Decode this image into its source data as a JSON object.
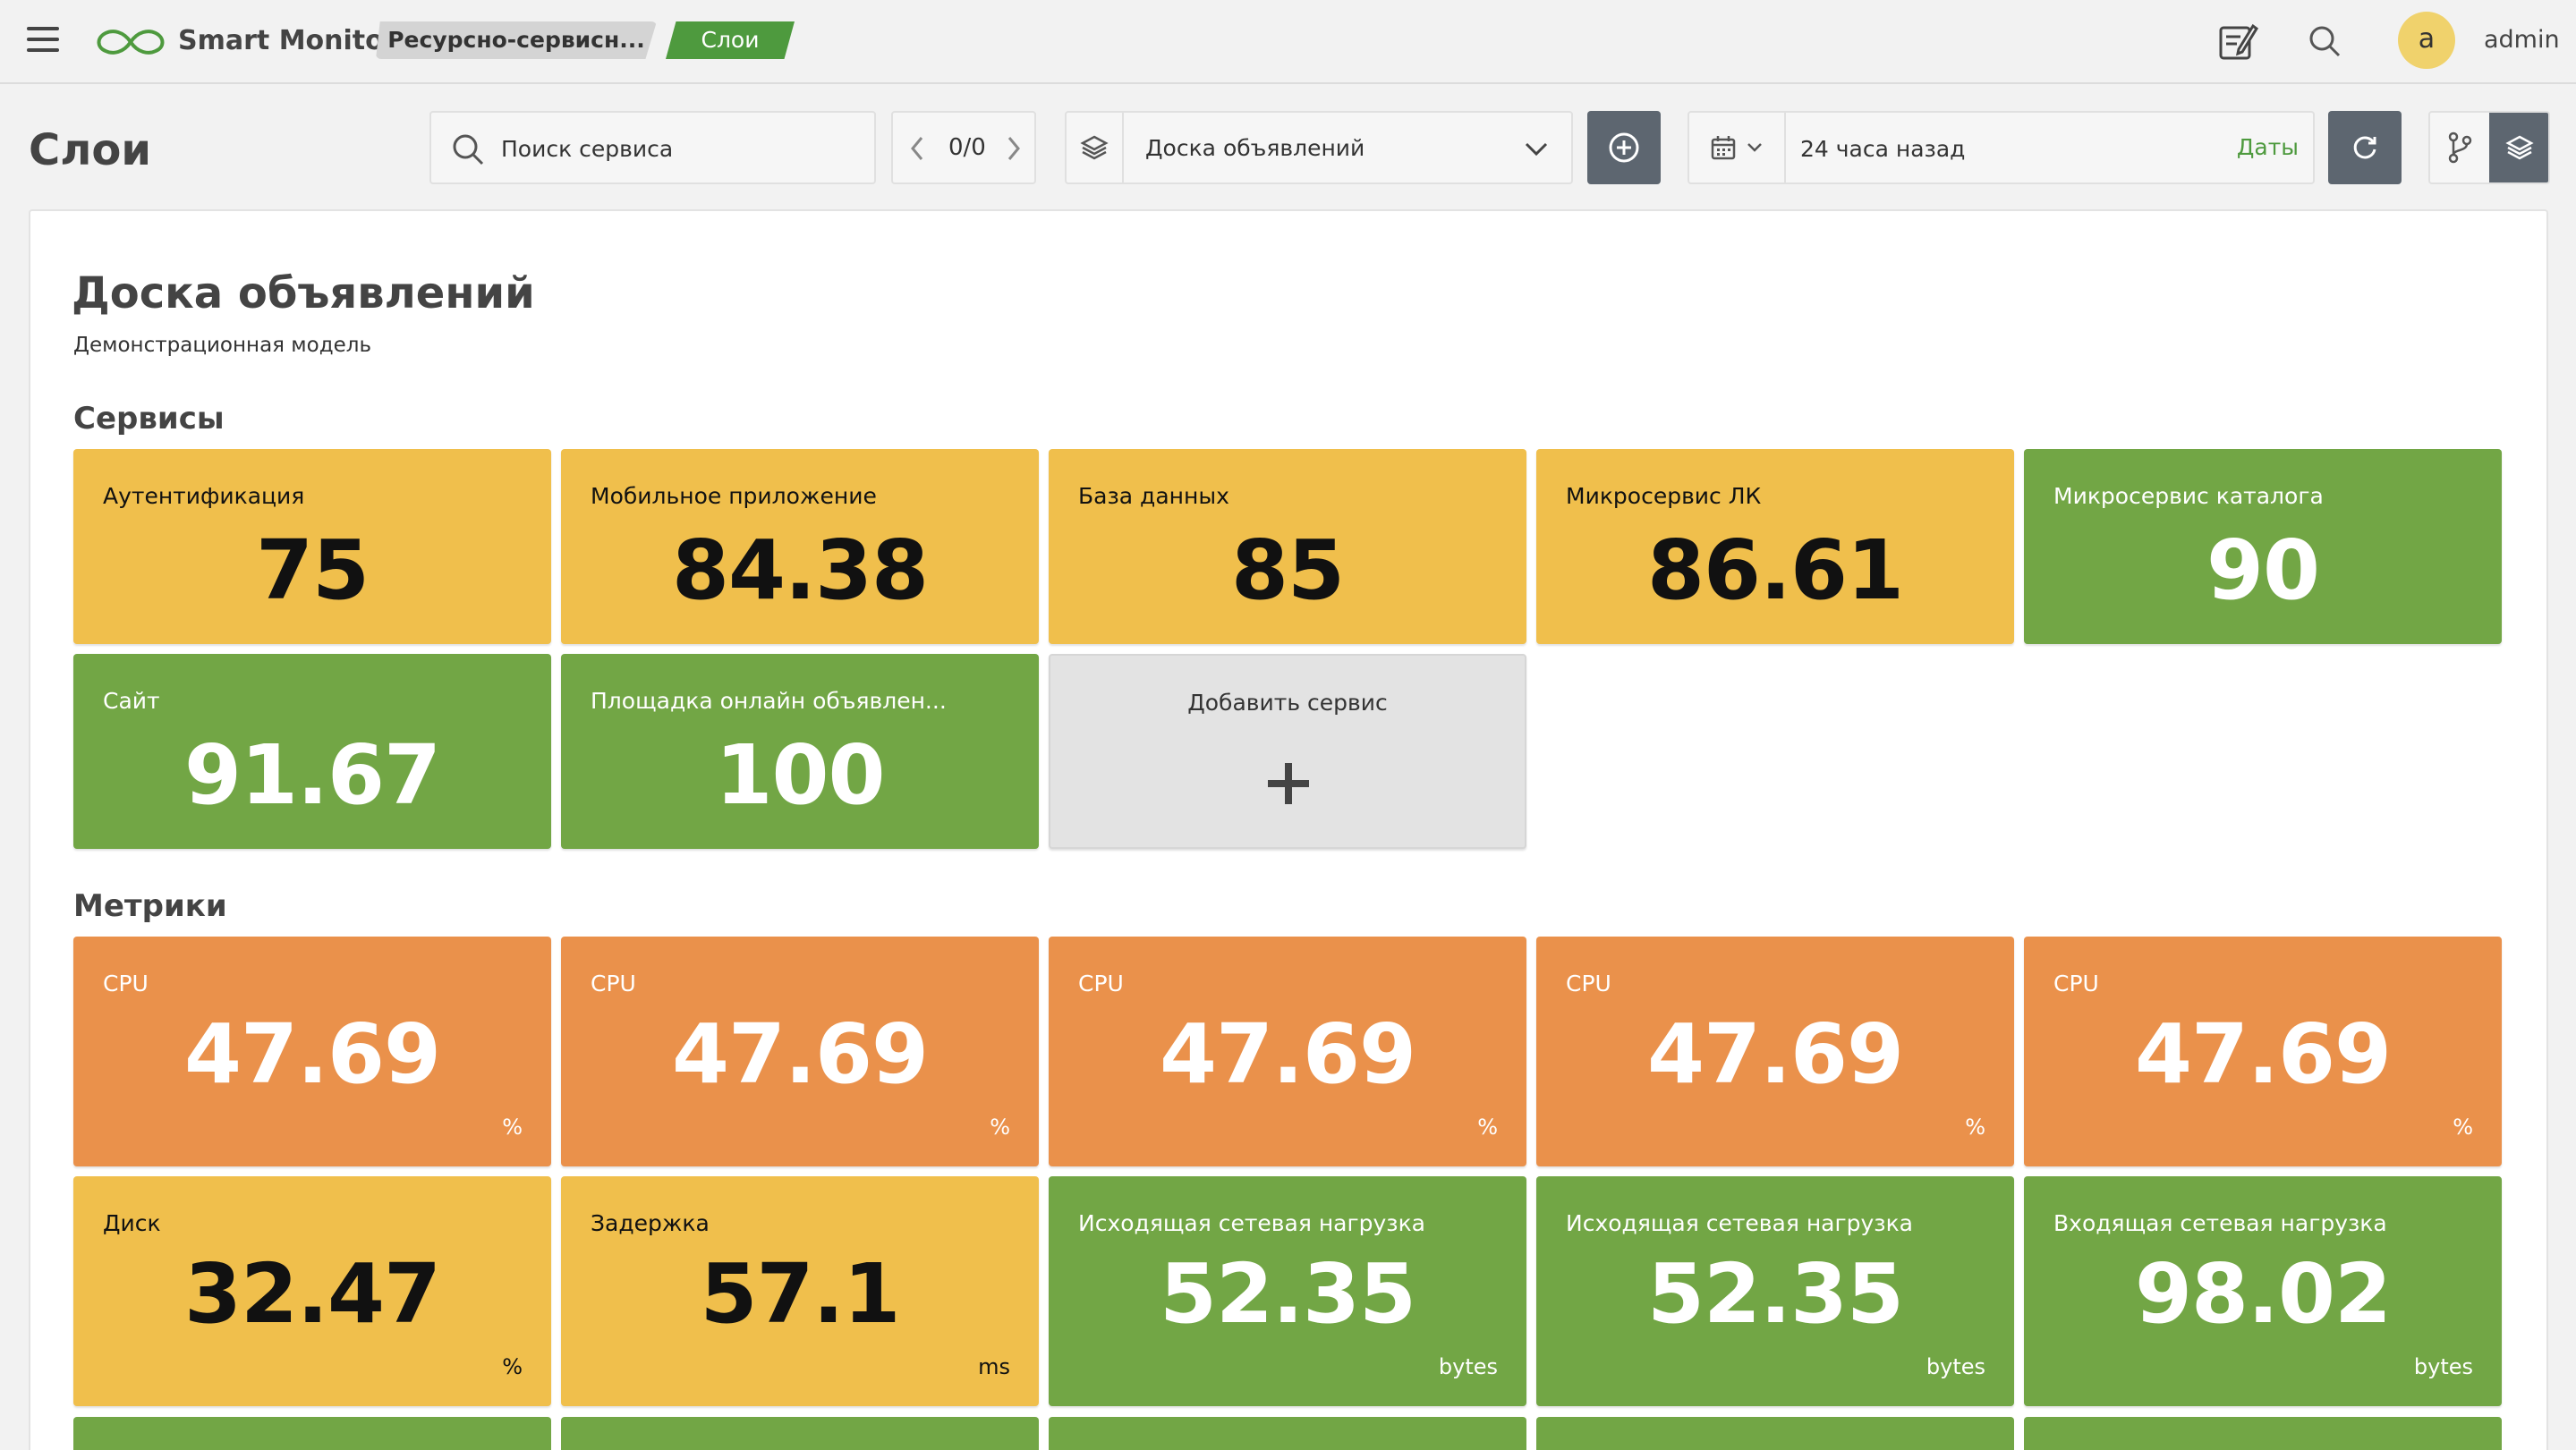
{
  "header": {
    "brand": "Smart Monitor",
    "breadcrumbs": [
      "Ресурсно-сервисн...",
      "Слои"
    ],
    "user": {
      "avatar_letter": "a",
      "name": "admin"
    },
    "icons": [
      "menu-icon",
      "infinity-logo-icon",
      "edit-note-icon",
      "search-icon"
    ]
  },
  "toolbar": {
    "page_title": "Слои",
    "search_placeholder": "Поиск сервиса",
    "pager": "0/0",
    "layer": "Доска объявлений",
    "time_range": "24 часа назад",
    "dates_link": "Даты"
  },
  "model": {
    "title": "Доска объявлений",
    "subtitle": "Демонстрационная модель"
  },
  "services": {
    "title": "Сервисы",
    "tiles": [
      {
        "name": "Аутентификация",
        "value": "75",
        "status": "yellow"
      },
      {
        "name": "Мобильное приложение",
        "value": "84.38",
        "status": "yellow"
      },
      {
        "name": "База данных",
        "value": "85",
        "status": "yellow"
      },
      {
        "name": "Микросервис ЛК",
        "value": "86.61",
        "status": "yellow"
      },
      {
        "name": "Микросервис каталога",
        "value": "90",
        "status": "green"
      },
      {
        "name": "Сайт",
        "value": "91.67",
        "status": "green"
      },
      {
        "name": "Площадка онлайн объявлен...",
        "value": "100",
        "status": "green"
      }
    ],
    "add_label": "Добавить сервис"
  },
  "metrics": {
    "title": "Метрики",
    "tiles": [
      {
        "name": "CPU",
        "value": "47.69",
        "unit": "%",
        "status": "orange"
      },
      {
        "name": "CPU",
        "value": "47.69",
        "unit": "%",
        "status": "orange"
      },
      {
        "name": "CPU",
        "value": "47.69",
        "unit": "%",
        "status": "orange"
      },
      {
        "name": "CPU",
        "value": "47.69",
        "unit": "%",
        "status": "orange"
      },
      {
        "name": "CPU",
        "value": "47.69",
        "unit": "%",
        "status": "orange"
      },
      {
        "name": "Диск",
        "value": "32.47",
        "unit": "%",
        "status": "yellow"
      },
      {
        "name": "Задержка",
        "value": "57.1",
        "unit": "ms",
        "status": "yellow"
      },
      {
        "name": "Исходящая сетевая нагрузка",
        "value": "52.35",
        "unit": "bytes",
        "status": "green"
      },
      {
        "name": "Исходящая сетевая нагрузка",
        "value": "52.35",
        "unit": "bytes",
        "status": "green"
      },
      {
        "name": "Входящая сетевая нагрузка",
        "value": "98.02",
        "unit": "bytes",
        "status": "green"
      }
    ]
  },
  "colors": {
    "yellow": "#f0bf4c",
    "green": "#72a645",
    "orange": "#ea914b",
    "accent_green": "#4e9a3e",
    "dark_button": "#5d6670",
    "add_tile": "#e3e3e3"
  }
}
